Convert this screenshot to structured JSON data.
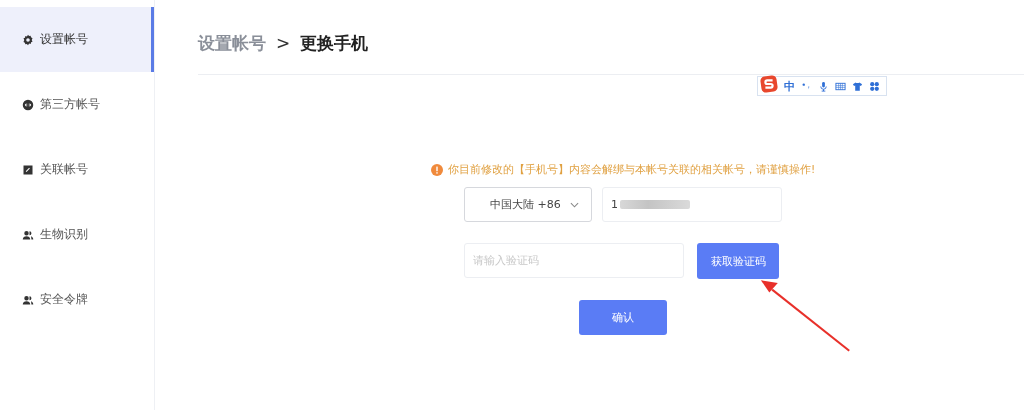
{
  "sidebar": {
    "items": [
      {
        "label": "设置帐号",
        "kind": "settings",
        "selected": true
      },
      {
        "label": "第三方帐号",
        "kind": "thirdparty",
        "selected": false
      },
      {
        "label": "关联帐号",
        "kind": "linked",
        "selected": false
      },
      {
        "label": "生物识别",
        "kind": "user",
        "selected": false
      },
      {
        "label": "安全令牌",
        "kind": "user",
        "selected": false
      }
    ]
  },
  "breadcrumb": {
    "parent": "设置帐号",
    "separator": ">",
    "current": "更换手机"
  },
  "ime_toolbar": {
    "mode": "中"
  },
  "warning": "你目前修改的【手机号】内容会解绑与本帐号关联的相关帐号，请谨慎操作!",
  "form": {
    "region": "中国大陆 +86",
    "phone_value": "1",
    "code_placeholder": "请输入验证码",
    "get_code_button": "获取验证码",
    "confirm_button": "确认"
  }
}
